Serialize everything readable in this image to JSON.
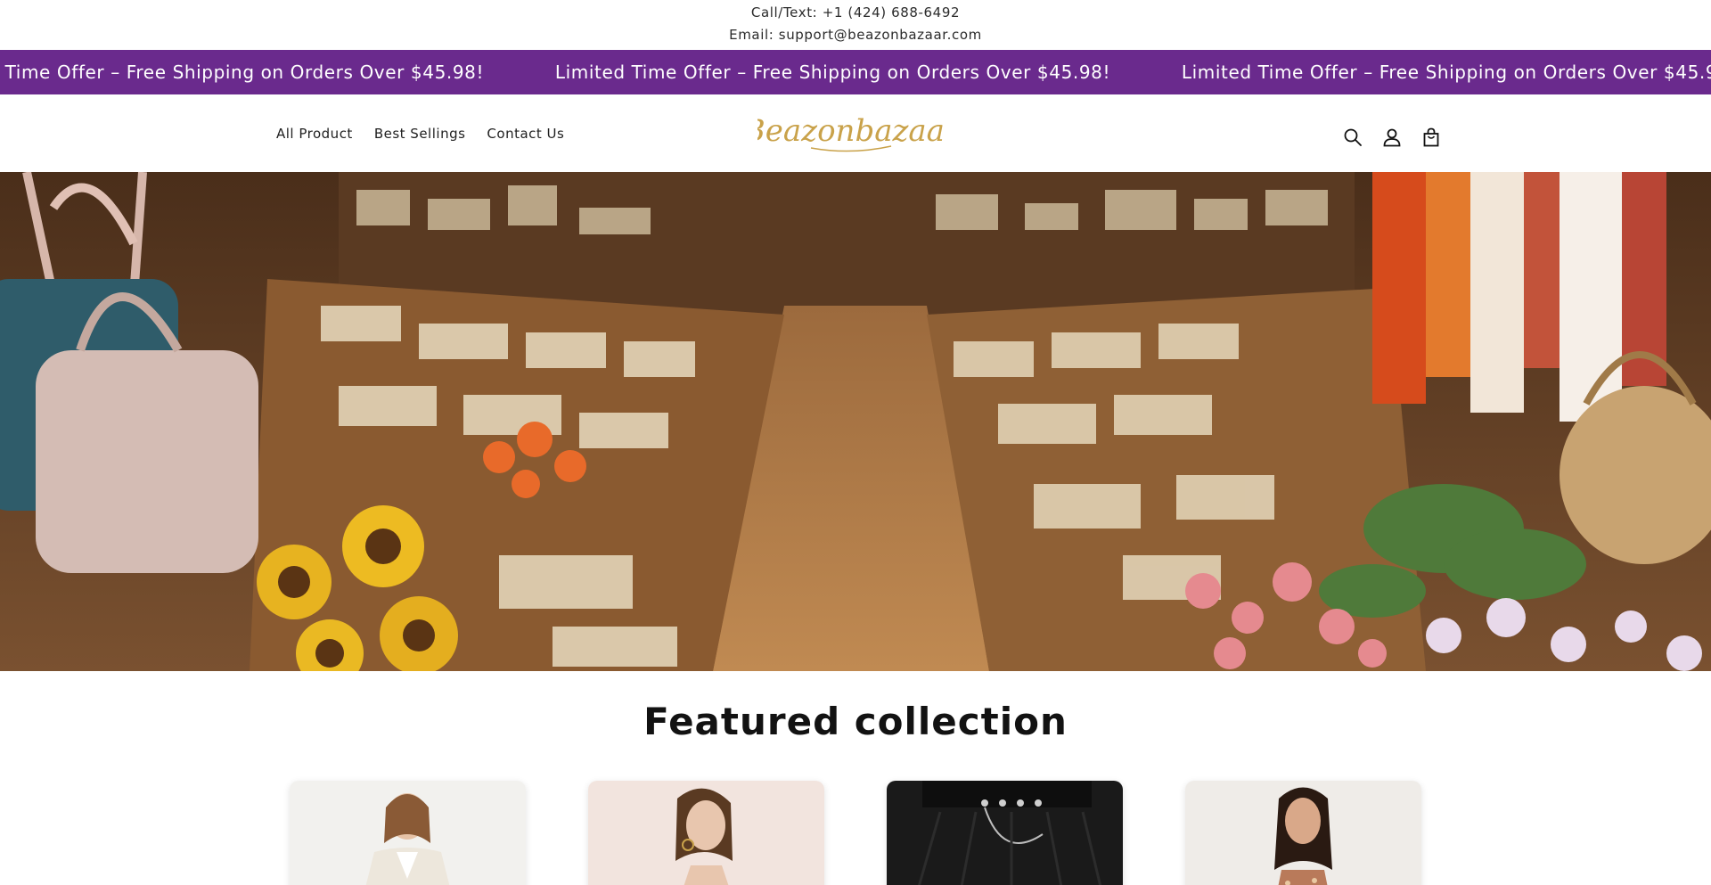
{
  "contact": {
    "phone": "Call/Text: +1 (424) 688-6492",
    "email": "Email: support@beazonbazaar.com"
  },
  "announcement": {
    "text": "Limited Time Offer – Free Shipping on Orders Over $45.98!",
    "background": "#6a2a8d"
  },
  "nav": {
    "items": [
      {
        "label": "All Product"
      },
      {
        "label": "Best Sellings"
      },
      {
        "label": "Contact Us"
      }
    ]
  },
  "brand": {
    "logo_text": "Beazonbazaar",
    "logo_color": "#c9a24a"
  },
  "header_icons": [
    "search-icon",
    "account-icon",
    "cart-icon"
  ],
  "hero": {
    "alt": "Market stall with handbags, sunflowers and flowers"
  },
  "featured": {
    "title": "Featured collection",
    "products": [
      {
        "image": "woman-in-white-blazer"
      },
      {
        "image": "woman-with-hoop-earrings"
      },
      {
        "image": "black-pleated-skirt-with-chain"
      },
      {
        "image": "woman-in-sequin-top"
      }
    ]
  }
}
